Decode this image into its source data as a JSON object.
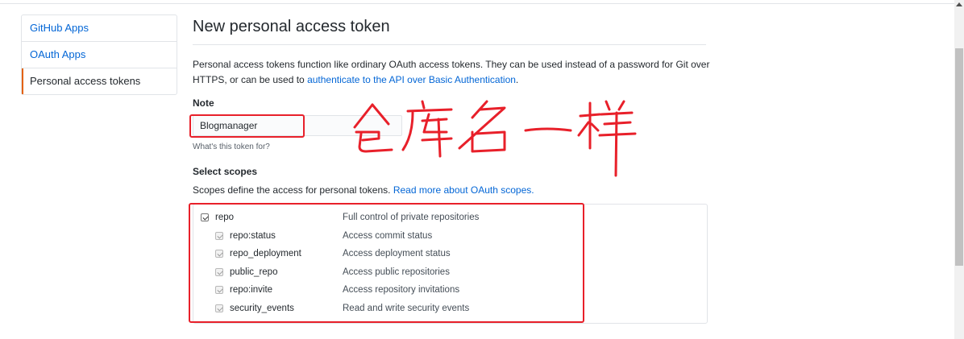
{
  "sidebar": {
    "items": [
      {
        "label": "GitHub Apps",
        "active": false
      },
      {
        "label": "OAuth Apps",
        "active": false
      },
      {
        "label": "Personal access tokens",
        "active": true
      }
    ]
  },
  "page": {
    "title": "New personal access token",
    "intro_text": "Personal access tokens function like ordinary OAuth access tokens. They can be used instead of a password for Git over HTTPS, or can be used to ",
    "intro_link": "authenticate to the API over Basic Authentication",
    "intro_end": "."
  },
  "note": {
    "label": "Note",
    "value": "Blogmanager",
    "hint": "What's this token for?"
  },
  "scopes": {
    "label": "Select scopes",
    "desc_text": "Scopes define the access for personal tokens. ",
    "desc_link": "Read more about OAuth scopes.",
    "items": [
      {
        "name": "repo",
        "description": "Full control of private repositories",
        "checked": true
      },
      {
        "name": "repo:status",
        "description": "Access commit status",
        "checked": true
      },
      {
        "name": "repo_deployment",
        "description": "Access deployment status",
        "checked": true
      },
      {
        "name": "public_repo",
        "description": "Access public repositories",
        "checked": true
      },
      {
        "name": "repo:invite",
        "description": "Access repository invitations",
        "checked": true
      },
      {
        "name": "security_events",
        "description": "Read and write security events",
        "checked": true
      }
    ]
  },
  "annotation": {
    "handwritten_text": "仓库名一样",
    "color": "#e8202a"
  },
  "colors": {
    "link": "#0366d6",
    "active_accent": "#e36209",
    "annotation_red": "#e8202a"
  }
}
